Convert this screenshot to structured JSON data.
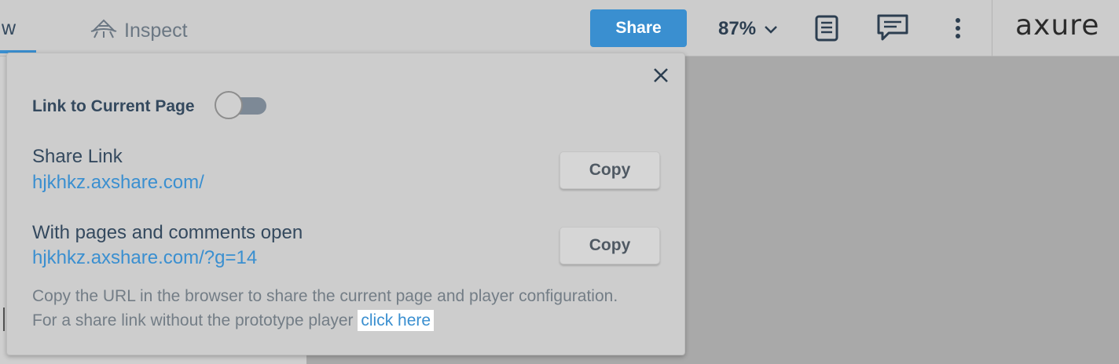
{
  "toolbar": {
    "partial_tab_label": "w",
    "inspect_label": "Inspect",
    "share_label": "Share",
    "zoom_value": "87%",
    "logo_text": "axure",
    "colors": {
      "accent": "#3a8fd0",
      "toolbar_bg": "#cccccc"
    }
  },
  "popover": {
    "link_current_label": "Link to Current Page",
    "toggle_on": false,
    "share_link": {
      "title": "Share Link",
      "url": "hjkhkz.axshare.com/",
      "copy_label": "Copy"
    },
    "pages_link": {
      "title": "With pages and comments open",
      "url": "hjkhkz.axshare.com/?g=14",
      "copy_label": "Copy"
    },
    "note_line1": "Copy the URL in the browser to share the current page and player configuration.",
    "note_line2": "For a share link without the prototype player",
    "click_here": "click here"
  },
  "icons": {
    "inspect": "inspect-icon",
    "zoom_dropdown": "chevron-down-icon",
    "notes": "notes-icon",
    "comments": "comment-icon",
    "more": "more-vertical-icon",
    "close": "close-icon"
  }
}
